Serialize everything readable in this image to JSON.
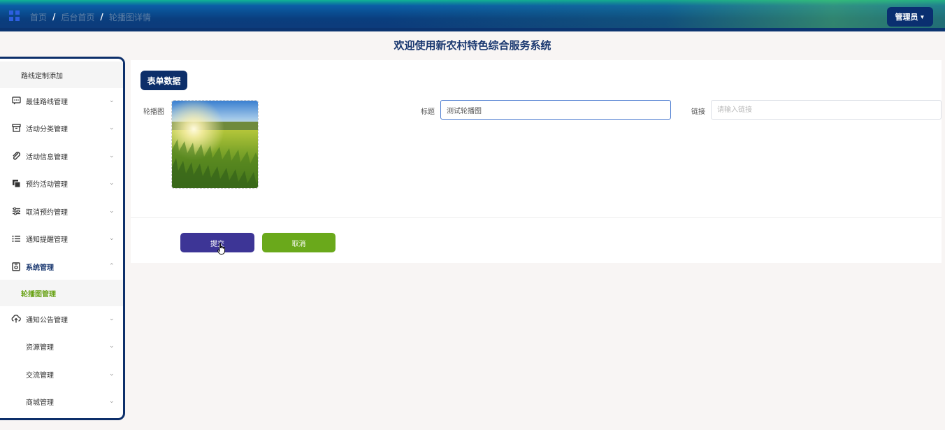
{
  "header": {
    "breadcrumb": [
      "首页",
      "后台首页",
      "轮播图详情"
    ],
    "separator": "/",
    "user_button": "管理员"
  },
  "page_title": "欢迎使用新农村特色综合服务系统",
  "sidebar": {
    "items": [
      {
        "label": "路线定制添加",
        "icon": "none"
      },
      {
        "label": "最佳路线管理",
        "icon": "message-icon"
      },
      {
        "label": "活动分类管理",
        "icon": "archive-icon"
      },
      {
        "label": "活动信息管理",
        "icon": "paperclip-icon"
      },
      {
        "label": "预约活动管理",
        "icon": "copy-icon"
      },
      {
        "label": "取消预约管理",
        "icon": "sliders-icon"
      },
      {
        "label": "通知提醒管理",
        "icon": "list-icon"
      },
      {
        "label": "系统管理",
        "icon": "settings-box-icon",
        "expanded": true
      },
      {
        "label": "轮播图管理",
        "icon": "none",
        "active": true
      },
      {
        "label": "通知公告管理",
        "icon": "cloud-upload-icon"
      },
      {
        "label": "资源管理",
        "icon": "none"
      },
      {
        "label": "交流管理",
        "icon": "none"
      },
      {
        "label": "商城管理",
        "icon": "none"
      }
    ],
    "active_color": "#6aa317"
  },
  "form": {
    "section_tag": "表单数据",
    "image_label": "轮播图",
    "title_label": "标题",
    "title_value": "测试轮播图",
    "link_label": "链接",
    "link_placeholder": "请输入链接",
    "submit_label": "提交",
    "cancel_label": "取消"
  },
  "colors": {
    "brand_dark": "#0d2f6a",
    "submit": "#3d3596",
    "cancel": "#6aa91b"
  }
}
